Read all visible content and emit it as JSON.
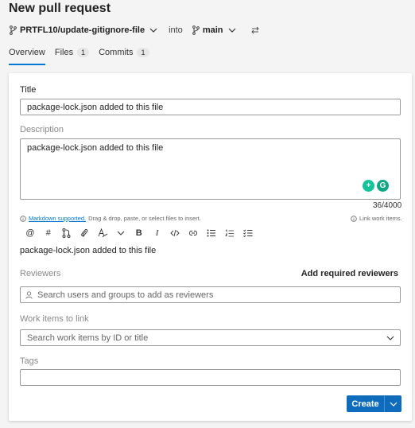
{
  "page": {
    "title": "New pull request"
  },
  "branches": {
    "source": "PRTFL10/update-gitignore-file",
    "into_label": "into",
    "target": "main"
  },
  "tabs": [
    {
      "label": "Overview"
    },
    {
      "label": "Files",
      "count": "1"
    },
    {
      "label": "Commits",
      "count": "1"
    }
  ],
  "form": {
    "title_label": "Title",
    "title_value": "package-lock.json added to this file",
    "description_label": "Description",
    "description_value": "package-lock.json added to this file",
    "char_count": "36/4000",
    "markdown_link": "Markdown supported.",
    "markdown_hint": "Drag & drop, paste, or select files to insert.",
    "link_work_items": "Link work items.",
    "preview_text": "package-lock.json added to this file",
    "reviewers_label": "Reviewers",
    "add_required_reviewers": "Add required reviewers",
    "reviewers_placeholder": "Search users and groups to add as reviewers",
    "work_items_label": "Work items to link",
    "work_items_placeholder": "Search work items by ID or title",
    "tags_label": "Tags",
    "tags_value": "",
    "create_label": "Create"
  },
  "toolbar": [
    "mention-icon",
    "hashtag-icon",
    "pull-request-icon",
    "attach-icon",
    "format-icon",
    "chevron-down-icon",
    "bold-icon",
    "italic-icon",
    "code-icon",
    "link-icon",
    "bulleted-list-icon",
    "numbered-list-icon",
    "task-list-icon"
  ],
  "colors": {
    "accent": "#0f6cbd",
    "tab_underline": "#0078d4"
  }
}
